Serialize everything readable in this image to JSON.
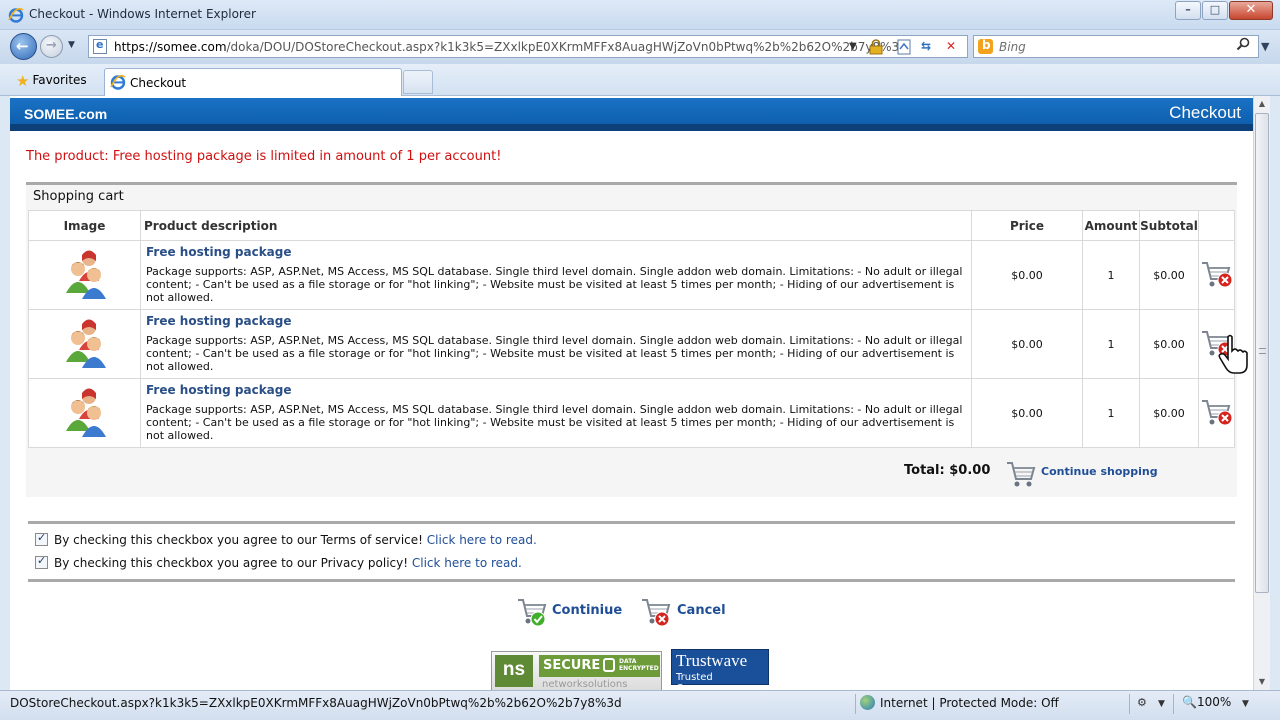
{
  "window": {
    "title": "Checkout - Windows Internet Explorer",
    "close_label": "✕",
    "minimize_label": "–",
    "maximize_label": "□"
  },
  "address_bar": {
    "url_host": "https://somee.com",
    "url_rest": "/doka/DOU/DOStoreCheckout.aspx?k1k3k5=ZXxlkpE0XKrmMFFx8AuagHWjZoVn0bPtwq%2b%2b62O%2b7y8%3d"
  },
  "search": {
    "placeholder": "Bing"
  },
  "favorites": {
    "label": "Favorites"
  },
  "tabs": [
    {
      "label": "Checkout"
    }
  ],
  "site": {
    "brand": "SOMEE.com",
    "page_title": "Checkout"
  },
  "alert": "The product: Free hosting package is limited in amount of 1 per account!",
  "cart": {
    "title": "Shopping cart",
    "columns": [
      "Image",
      "Product description",
      "Price",
      "Amount",
      "Subtotal"
    ],
    "rows": [
      {
        "name": "Free hosting package",
        "description": "Package supports: ASP, ASP.Net, MS Access, MS SQL database. Single third level domain. Single addon web domain. Limitations: - No adult or illegal content; - Can't be used as a file storage or for \"hot linking\"; - Website must be visited at least 5 times per month; - Hiding of our advertisement is not allowed.",
        "price": "$0.00",
        "amount": "1",
        "subtotal": "$0.00"
      },
      {
        "name": "Free hosting package",
        "description": "Package supports: ASP, ASP.Net, MS Access, MS SQL database. Single third level domain. Single addon web domain. Limitations: - No adult or illegal content; - Can't be used as a file storage or for \"hot linking\"; - Website must be visited at least 5 times per month; - Hiding of our advertisement is not allowed.",
        "price": "$0.00",
        "amount": "1",
        "subtotal": "$0.00"
      },
      {
        "name": "Free hosting package",
        "description": "Package supports: ASP, ASP.Net, MS Access, MS SQL database. Single third level domain. Single addon web domain. Limitations: - No adult or illegal content; - Can't be used as a file storage or for \"hot linking\"; - Website must be visited at least 5 times per month; - Hiding of our advertisement is not allowed.",
        "price": "$0.00",
        "amount": "1",
        "subtotal": "$0.00"
      }
    ],
    "total_label": "Total: $0.00",
    "continue_shopping": "Continue shopping"
  },
  "terms": [
    {
      "text": "By checking this checkbox you agree to our Terms of service! ",
      "link": "Click here to read.",
      "checked": true
    },
    {
      "text": "By checking this checkbox you agree to our Privacy policy! ",
      "link": "Click here to read.",
      "checked": true
    }
  ],
  "actions": {
    "continue_label": "Continiue",
    "cancel_label": "Cancel"
  },
  "badges": {
    "ns_logo": "ns",
    "ns_secure": "SECURE",
    "ns_encrypted": "DATA ENCRYPTED",
    "ns_company": "networksolutions",
    "tw_name": "Trustwave",
    "tw_sub": "Trusted Commerce"
  },
  "status": {
    "text": "DOStoreCheckout.aspx?k1k3k5=ZXxlkpE0XKrmMFFx8AuagHWjZoVn0bPtwq%2b%2b62O%2b7y8%3d",
    "zone": "Internet | Protected Mode: Off",
    "zoom": "100%"
  },
  "colors": {
    "brand_blue": "#0b5aa8",
    "alert_red": "#d01010",
    "link_blue": "#1f4e96"
  }
}
